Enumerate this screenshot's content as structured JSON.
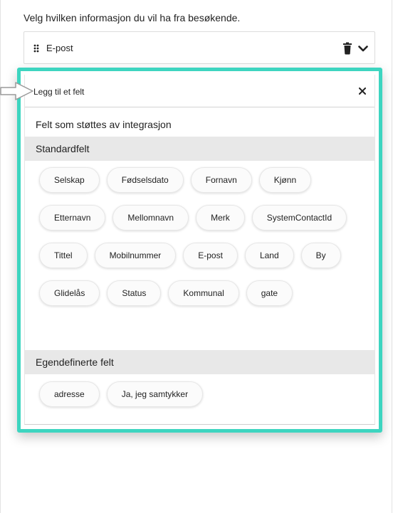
{
  "instruction": "Velg hvilken informasjon du vil ha fra besøkende.",
  "selected_field": {
    "label": "E-post"
  },
  "panel": {
    "title": "Legg til et felt",
    "supported_label": "Felt som støttes av integrasjon",
    "standard_section": {
      "title": "Standardfelt",
      "fields": [
        "Selskap",
        "Fødselsdato",
        "Fornavn",
        "Kjønn",
        "Etternavn",
        "Mellomnavn",
        "Merk",
        "SystemContactId",
        "Tittel",
        "Mobilnummer",
        "E-post",
        "Land",
        "By",
        "Glidelås",
        "Status",
        "Kommunal",
        "gate"
      ]
    },
    "custom_section": {
      "title": "Egendefinerte felt",
      "fields": [
        "adresse",
        "Ja, jeg samtykker"
      ]
    }
  },
  "colors": {
    "highlight": "#3dd5c0",
    "section_background": "#e8e8e8"
  },
  "icons": [
    "drag-handle-icon",
    "trash-icon",
    "chevron-down-icon",
    "close-icon",
    "pointer-arrow-icon"
  ]
}
